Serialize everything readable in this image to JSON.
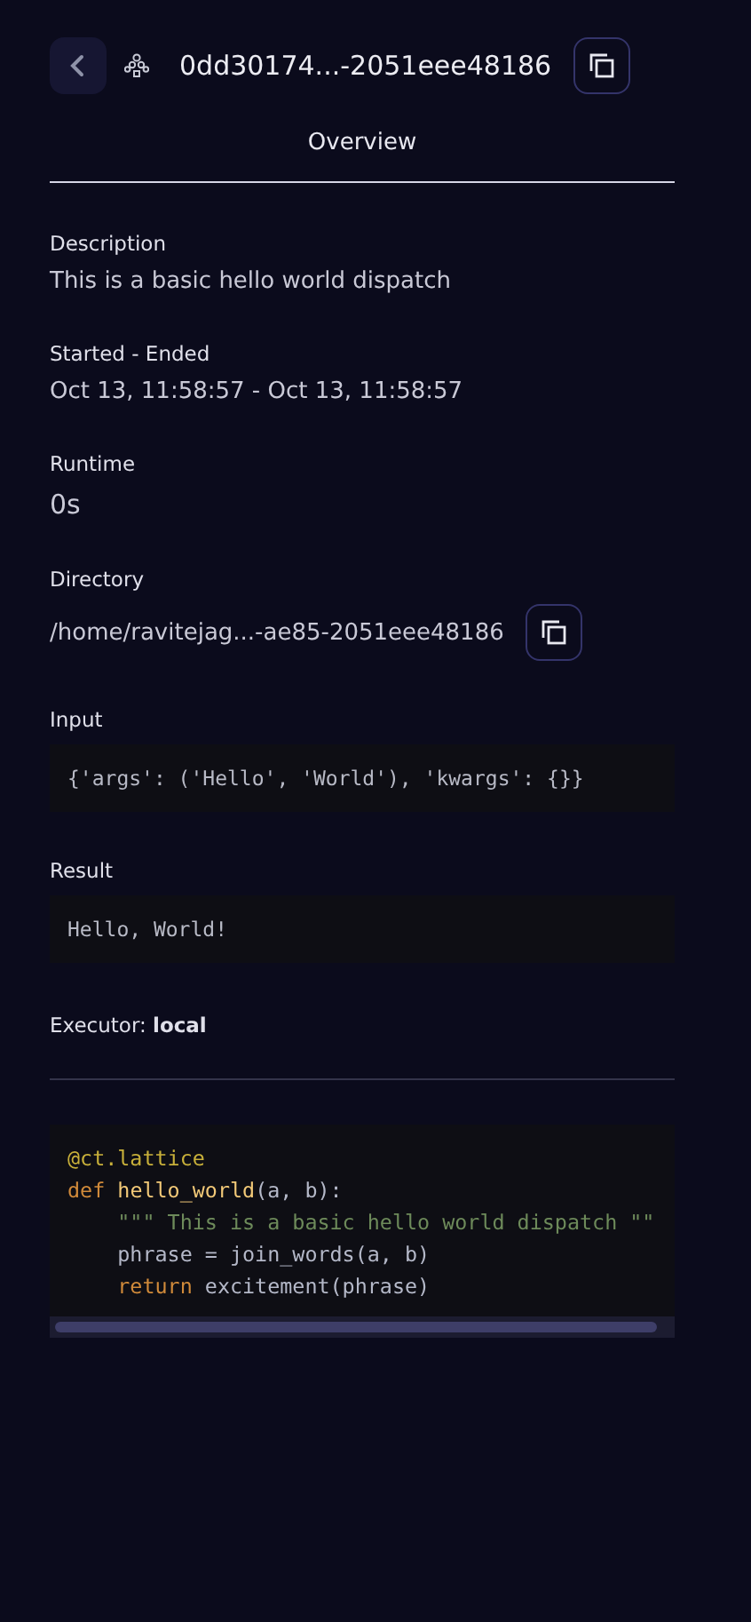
{
  "header": {
    "title": "0dd30174...-2051eee48186"
  },
  "tabs": [
    {
      "label": "Overview",
      "selected": true
    }
  ],
  "fields": [
    {
      "label": "Description",
      "value": "This is a basic hello world dispatch",
      "kind": "text"
    },
    {
      "label": "Started - Ended",
      "value": "Oct 13, 11:58:57 - Oct 13, 11:58:57",
      "kind": "text"
    },
    {
      "label": "Runtime",
      "value": "0s",
      "kind": "large"
    },
    {
      "label": "Directory",
      "value": "/home/ravitejag...-ae85-2051eee48186",
      "kind": "copy"
    },
    {
      "label": "Input",
      "value": "{'args': ('Hello', 'World'), 'kwargs': {}}",
      "kind": "code"
    },
    {
      "label": "Result",
      "value": "Hello, World!",
      "kind": "code"
    }
  ],
  "executor": "Executor: **local**",
  "code": [
    {
      "indented": false,
      "tokens": [
        {
          "kind": "decorator",
          "text": "@ct.lattice"
        }
      ]
    },
    {
      "indented": false,
      "tokens": [
        {
          "kind": "keyword",
          "text": "def "
        },
        {
          "kind": "function",
          "text": "hello_world"
        },
        {
          "kind": "plain",
          "text": "(a, b):"
        }
      ]
    },
    {
      "indented": true,
      "tokens": [
        {
          "kind": "string",
          "text": "\"\"\" This is a basic hello world dispatch \"\""
        }
      ]
    },
    {
      "indented": true,
      "tokens": [
        {
          "kind": "plain",
          "text": "phrase = join_words(a, b)"
        }
      ]
    },
    {
      "indented": true,
      "tokens": [
        {
          "kind": "keyword",
          "text": "return "
        },
        {
          "kind": "plain",
          "text": "excitement(phrase)"
        }
      ]
    }
  ]
}
